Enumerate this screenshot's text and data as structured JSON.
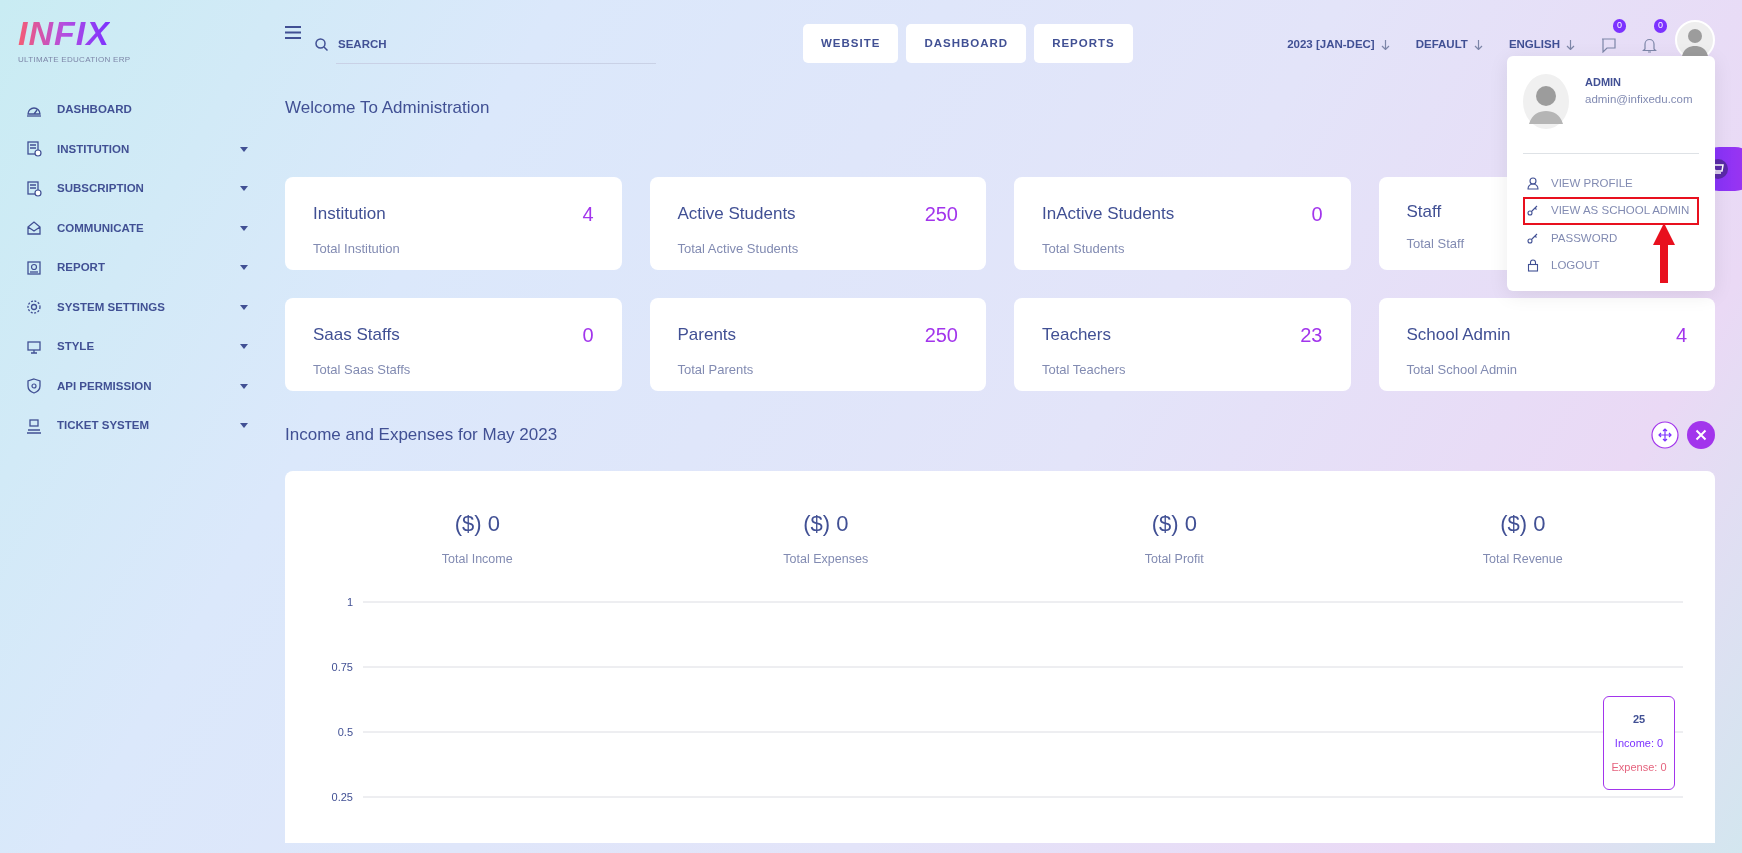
{
  "logo": {
    "title": "INFIX",
    "tagline": "ULTIMATE EDUCATION ERP"
  },
  "sidebar": {
    "items": [
      {
        "label": "DASHBOARD",
        "has_caret": false
      },
      {
        "label": "INSTITUTION",
        "has_caret": true
      },
      {
        "label": "SUBSCRIPTION",
        "has_caret": true
      },
      {
        "label": "COMMUNICATE",
        "has_caret": true
      },
      {
        "label": "REPORT",
        "has_caret": true
      },
      {
        "label": "SYSTEM SETTINGS",
        "has_caret": true
      },
      {
        "label": "STYLE",
        "has_caret": true
      },
      {
        "label": "API PERMISSION",
        "has_caret": true
      },
      {
        "label": "TICKET SYSTEM",
        "has_caret": true
      }
    ]
  },
  "header": {
    "search": {
      "placeholder": "SEARCH"
    },
    "buttons": [
      "WEBSITE",
      "DASHBOARD",
      "REPORTS"
    ],
    "selectors": [
      "2023 [JAN-DEC]",
      "DEFAULT",
      "ENGLISH"
    ],
    "chat_badge": "0",
    "notification_badge": "0"
  },
  "welcome_title": "Welcome To Administration",
  "stat_cards": [
    {
      "title": "Institution",
      "value": "4",
      "subtitle": "Total Institution"
    },
    {
      "title": "Active Students",
      "value": "250",
      "subtitle": "Total Active Students"
    },
    {
      "title": "InActive Students",
      "value": "0",
      "subtitle": "Total Students"
    },
    {
      "title": "Staff",
      "subtitle": "Total Staff"
    },
    {
      "title": "Saas Staffs",
      "value": "0",
      "subtitle": "Total Saas Staffs"
    },
    {
      "title": "Parents",
      "value": "250",
      "subtitle": "Total Parents"
    },
    {
      "title": "Teachers",
      "value": "23",
      "subtitle": "Total Teachers"
    },
    {
      "title": "School Admin",
      "value": "4",
      "subtitle": "Total School Admin"
    }
  ],
  "income_section": {
    "title": "Income and Expenses for May 2023",
    "totals": [
      {
        "amount": "($) 0",
        "label": "Total Income"
      },
      {
        "amount": "($) 0",
        "label": "Total Expenses"
      },
      {
        "amount": "($) 0",
        "label": "Total Profit"
      },
      {
        "amount": "($) 0",
        "label": "Total Revenue"
      }
    ],
    "y_axis_labels": [
      "1",
      "0.75",
      "0.5",
      "0.25"
    ],
    "tooltip": {
      "title": "25",
      "lines": [
        {
          "text": "Income: 0",
          "color": "#7c32ff"
        },
        {
          "text": "Expense: 0",
          "color": "#e5637e"
        }
      ]
    }
  },
  "profile_menu": {
    "name": "ADMIN",
    "email": "admin@infixedu.com",
    "items": [
      {
        "label": "VIEW PROFILE",
        "highlighted": false
      },
      {
        "label": "VIEW AS SCHOOL ADMIN",
        "highlighted": true
      },
      {
        "label": "PASSWORD",
        "highlighted": false
      },
      {
        "label": "LOGOUT",
        "highlighted": false
      }
    ]
  }
}
